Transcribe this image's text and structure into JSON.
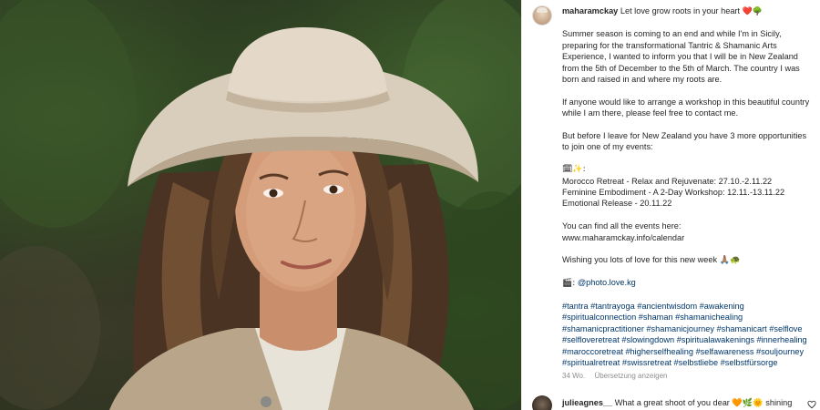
{
  "post": {
    "username": "maharamckay",
    "headline": "Let love grow roots in your heart",
    "headline_emoji": "❤️🌳",
    "paragraphs": [
      "Summer season is coming to an end and while I'm in Sicily, preparing for the transformational Tantric & Shamanic Arts Experience, I wanted to inform you that I will be in New Zealand from the 5th of December to the 5th of March. The country I was born and raised in and where my roots are.",
      "If anyone would like to arrange a workshop in this beautiful country while I am there, please feel free to contact me.",
      "But before I leave for New Zealand you have 3 more opportunities to join one of my events:"
    ],
    "events_intro": "🗓✨:",
    "events": [
      "Morocco Retreat - Relax and Rejuvenate: 27.10.-2.11.22",
      "Feminine Embodiment - A 2-Day Workshop: 12.11.-13.11.22",
      "Emotional Release - 20.11.22"
    ],
    "events_link_label": "You can find all the events here:",
    "events_link": "www.maharamckay.info/calendar",
    "wish": "Wishing you lots of love for this new week 🙏🏽🐢",
    "photo_credit_icon": "🎬:",
    "photo_credit": "@photo.love.kg",
    "hashtags": "#tantra #tantrayoga #ancientwisdom #awakening #spiritualconnection #shaman #shamanichealing #shamanicpractitioner #shamanicjourney #shamanicart #selflove #selfloveretreat #slowingdown #spiritualawakenings #innerhealing #maroccoretreat #higherselfhealing #selfawareness #souljourney #spiritualretreat #swissretreat #selbstliebe #selbstfürsorge",
    "age": "34 Wo.",
    "translate": "Übersetzung anzeigen"
  },
  "comment": {
    "username": "julieagnes__",
    "text": "What a great shoot of you dear 🧡🌿🌞 shining"
  },
  "colors": {
    "hashtag": "#00376b",
    "text": "#262626",
    "meta": "#8e8e8e"
  }
}
